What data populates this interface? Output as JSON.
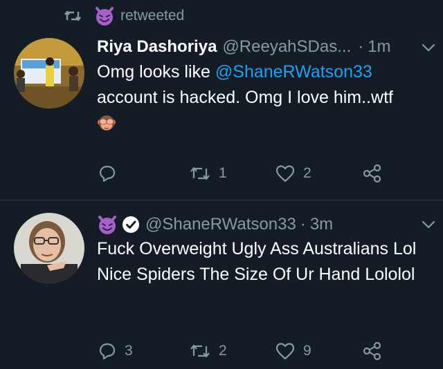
{
  "retweet_row": {
    "label": "retweeted"
  },
  "tweets": [
    {
      "name": "Riya Dashoriya",
      "handle": "@ReeyahSDas...",
      "separator": "·",
      "time": "1m",
      "text_before": "Omg looks like ",
      "mention": "@ShaneRWatson33",
      "text_after": " account is hacked. Omg I love him..wtf",
      "emoji": "see-no-evil-monkey",
      "actions": {
        "reply": "",
        "retweet": "1",
        "like": "2"
      }
    },
    {
      "name": "",
      "handle": "@ShaneRWatson33",
      "separator": "·",
      "time": "3m",
      "text": "Fuck Overweight Ugly Ass Australians Lol Nice Spiders The Size Of Ur Hand Lololol",
      "verified": true,
      "actions": {
        "reply": "3",
        "retweet": "2",
        "like": "9"
      }
    }
  ],
  "colors": {
    "background": "#141d26",
    "secondary_text": "#8899a6",
    "link": "#1da1f2",
    "divider": "#2b3a4a",
    "devil_purple": "#a361c9"
  }
}
